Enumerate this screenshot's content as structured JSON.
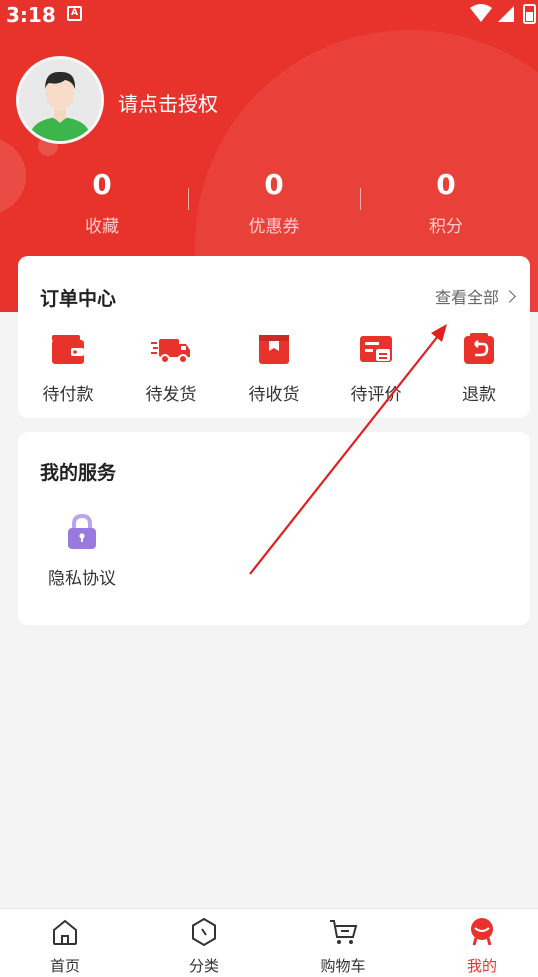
{
  "status_bar": {
    "time": "3:18",
    "notification_badge": "A"
  },
  "profile": {
    "login_prompt": "请点击授权"
  },
  "stats": [
    {
      "value": "0",
      "label": "收藏"
    },
    {
      "value": "0",
      "label": "优惠券"
    },
    {
      "value": "0",
      "label": "积分"
    }
  ],
  "orders": {
    "title": "订单中心",
    "view_all": "查看全部",
    "items": [
      {
        "label": "待付款",
        "icon": "wallet-icon"
      },
      {
        "label": "待发货",
        "icon": "truck-icon"
      },
      {
        "label": "待收货",
        "icon": "package-icon"
      },
      {
        "label": "待评价",
        "icon": "review-icon"
      },
      {
        "label": "退款",
        "icon": "refund-icon"
      }
    ]
  },
  "services": {
    "title": "我的服务",
    "items": [
      {
        "label": "隐私协议",
        "icon": "lock-icon"
      }
    ]
  },
  "tabbar": {
    "items": [
      {
        "label": "首页",
        "icon": "home-icon"
      },
      {
        "label": "分类",
        "icon": "category-icon"
      },
      {
        "label": "购物车",
        "icon": "cart-icon"
      },
      {
        "label": "我的",
        "icon": "profile-icon"
      }
    ],
    "active_index": 3
  },
  "colors": {
    "accent": "#e8332c",
    "background": "#f4f4f4",
    "lock": "#9b7ae0",
    "annotation_arrow": "#e02020"
  }
}
